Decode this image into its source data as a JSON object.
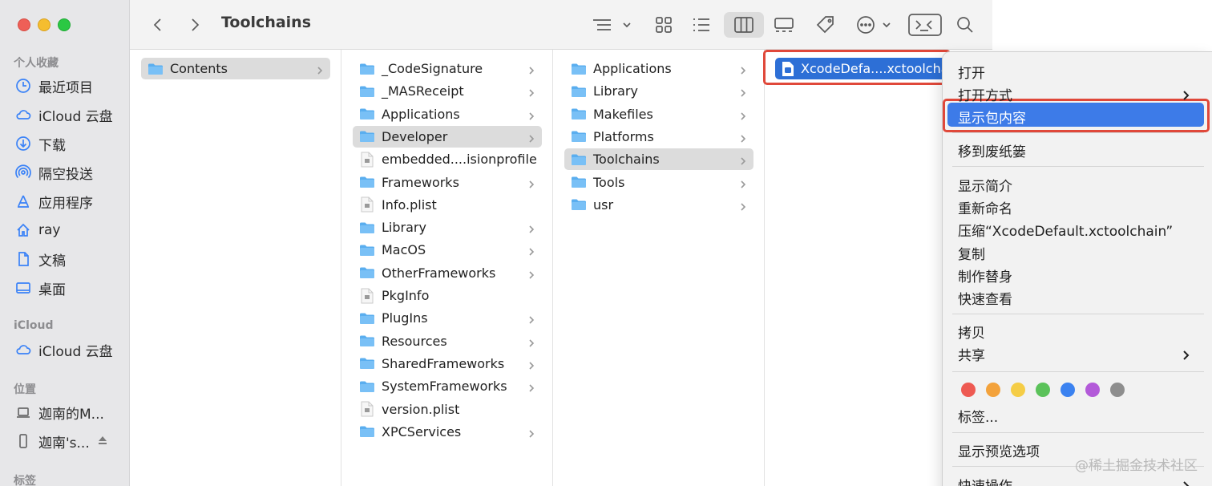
{
  "window": {
    "title": "Toolchains"
  },
  "sidebar": {
    "sections": [
      {
        "label": "个人收藏"
      },
      {
        "label": "iCloud"
      },
      {
        "label": "位置"
      },
      {
        "label": "标签"
      }
    ],
    "favorites": [
      {
        "label": "最近项目",
        "icon": "clock-icon"
      },
      {
        "label": "iCloud 云盘",
        "icon": "cloud-icon"
      },
      {
        "label": "下载",
        "icon": "download-icon"
      },
      {
        "label": "隔空投送",
        "icon": "airdrop-icon"
      },
      {
        "label": "应用程序",
        "icon": "apps-icon"
      },
      {
        "label": "ray",
        "icon": "home-icon"
      },
      {
        "label": "文稿",
        "icon": "document-icon"
      },
      {
        "label": "桌面",
        "icon": "desktop-icon"
      }
    ],
    "icloud": [
      {
        "label": "iCloud 云盘",
        "icon": "cloud-icon"
      }
    ],
    "locations": [
      {
        "label": "迦南的M...",
        "icon": "laptop-icon"
      },
      {
        "label": "迦南's...",
        "icon": "phone-icon"
      }
    ]
  },
  "columns": {
    "col1": [
      {
        "label": "Contents",
        "kind": "folder",
        "selected": true
      }
    ],
    "col2": [
      {
        "label": "_CodeSignature",
        "kind": "folder"
      },
      {
        "label": "_MASReceipt",
        "kind": "folder"
      },
      {
        "label": "Applications",
        "kind": "folder"
      },
      {
        "label": "Developer",
        "kind": "folder",
        "selected": true
      },
      {
        "label": "embedded....isionprofile",
        "kind": "file"
      },
      {
        "label": "Frameworks",
        "kind": "folder"
      },
      {
        "label": "Info.plist",
        "kind": "file"
      },
      {
        "label": "Library",
        "kind": "folder"
      },
      {
        "label": "MacOS",
        "kind": "folder"
      },
      {
        "label": "OtherFrameworks",
        "kind": "folder"
      },
      {
        "label": "PkgInfo",
        "kind": "file"
      },
      {
        "label": "PlugIns",
        "kind": "folder"
      },
      {
        "label": "Resources",
        "kind": "folder"
      },
      {
        "label": "SharedFrameworks",
        "kind": "folder"
      },
      {
        "label": "SystemFrameworks",
        "kind": "folder"
      },
      {
        "label": "version.plist",
        "kind": "file"
      },
      {
        "label": "XPCServices",
        "kind": "folder"
      }
    ],
    "col3": [
      {
        "label": "Applications",
        "kind": "folder"
      },
      {
        "label": "Library",
        "kind": "folder"
      },
      {
        "label": "Makefiles",
        "kind": "folder"
      },
      {
        "label": "Platforms",
        "kind": "folder"
      },
      {
        "label": "Toolchains",
        "kind": "folder",
        "selected": true
      },
      {
        "label": "Tools",
        "kind": "folder"
      },
      {
        "label": "usr",
        "kind": "folder"
      }
    ],
    "col4": [
      {
        "label": "XcodeDefa....xctoolchain",
        "kind": "package",
        "selected": true
      }
    ]
  },
  "context_menu": {
    "items": [
      {
        "label": "打开"
      },
      {
        "label": "打开方式",
        "submenu": true
      },
      {
        "label": "显示包内容",
        "highlighted": true
      },
      {
        "label": "移到废纸篓"
      },
      {
        "label": "显示简介"
      },
      {
        "label": "重新命名"
      },
      {
        "label": "压缩“XcodeDefault.xctoolchain”"
      },
      {
        "label": "复制"
      },
      {
        "label": "制作替身"
      },
      {
        "label": "快速查看"
      },
      {
        "label": "拷贝"
      },
      {
        "label": "共享",
        "submenu": true
      },
      {
        "label": "标签..."
      },
      {
        "label": "显示预览选项"
      },
      {
        "label": "快速操作",
        "submenu": true
      }
    ],
    "tag_colors": [
      "#ee5a52",
      "#f3a23b",
      "#f5cd46",
      "#5bc25a",
      "#3b82f0",
      "#b35ad9",
      "#8e8e8e"
    ]
  },
  "watermark": "@稀土掘金技术社区",
  "colors": {
    "accent": "#2d6fd6",
    "menu_highlight": "#3d7be8",
    "annotation_red": "#e0483a",
    "folder_blue": "#5aaeef"
  }
}
